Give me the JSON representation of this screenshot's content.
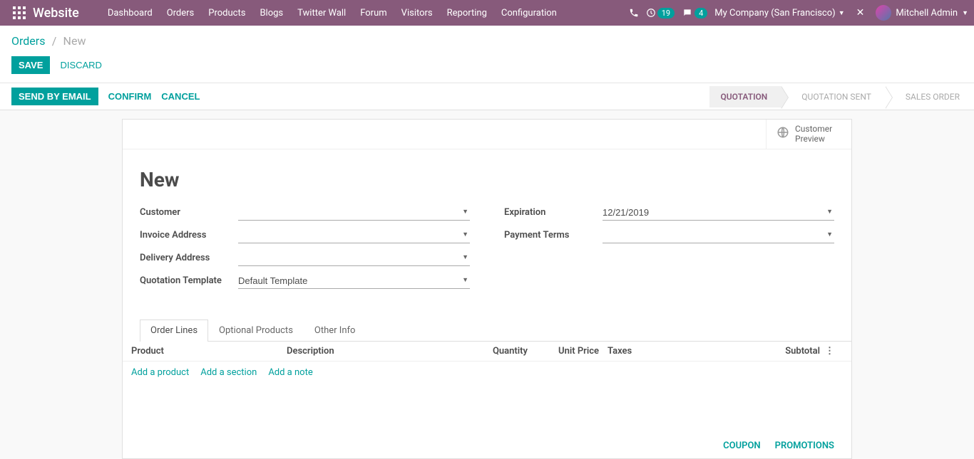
{
  "topbar": {
    "brand": "Website",
    "menu": [
      "Dashboard",
      "Orders",
      "Products",
      "Blogs",
      "Twitter Wall",
      "Forum",
      "Visitors",
      "Reporting",
      "Configuration"
    ],
    "clock_badge": "19",
    "chat_badge": "4",
    "company": "My Company (San Francisco)",
    "user": "Mitchell Admin"
  },
  "breadcrumb": {
    "root": "Orders",
    "current": "New"
  },
  "actions": {
    "save": "SAVE",
    "discard": "DISCARD"
  },
  "status_actions": {
    "send": "SEND BY EMAIL",
    "confirm": "CONFIRM",
    "cancel": "CANCEL"
  },
  "steps": {
    "quotation": "QUOTATION",
    "sent": "QUOTATION SENT",
    "order": "SALES ORDER"
  },
  "stat_btn": {
    "line1": "Customer",
    "line2": "Preview"
  },
  "title": "New",
  "fields": {
    "customer": {
      "label": "Customer",
      "value": ""
    },
    "invoice": {
      "label": "Invoice Address",
      "value": ""
    },
    "delivery": {
      "label": "Delivery Address",
      "value": ""
    },
    "template": {
      "label": "Quotation Template",
      "value": "Default Template"
    },
    "expiration": {
      "label": "Expiration",
      "value": "12/21/2019"
    },
    "terms": {
      "label": "Payment Terms",
      "value": ""
    }
  },
  "tabs": {
    "lines": "Order Lines",
    "optional": "Optional Products",
    "other": "Other Info"
  },
  "table_headers": {
    "product": "Product",
    "desc": "Description",
    "qty": "Quantity",
    "price": "Unit Price",
    "taxes": "Taxes",
    "subtotal": "Subtotal"
  },
  "add_links": {
    "product": "Add a product",
    "section": "Add a section",
    "note": "Add a note"
  },
  "bottom": {
    "coupon": "COUPON",
    "promotions": "PROMOTIONS"
  }
}
